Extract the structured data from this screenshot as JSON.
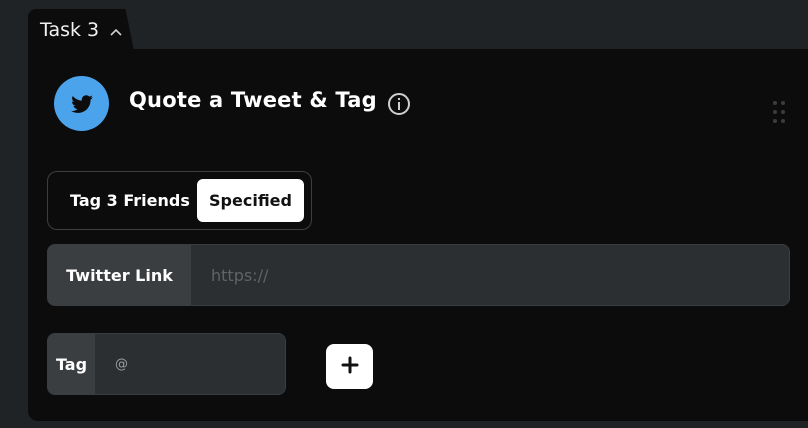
{
  "tab": {
    "label": "Task 3"
  },
  "task": {
    "title": "Quote a Tweet & Tag",
    "icon": "twitter-bird-icon",
    "accent": "#4ba3eb"
  },
  "mode": {
    "label": "Tag 3 Friends",
    "selected": "Specified"
  },
  "twitter_link": {
    "label": "Twitter Link",
    "placeholder": "https://"
  },
  "tag": {
    "label": "Tag",
    "placeholder": "@"
  },
  "add_button": {
    "icon": "plus-icon"
  }
}
